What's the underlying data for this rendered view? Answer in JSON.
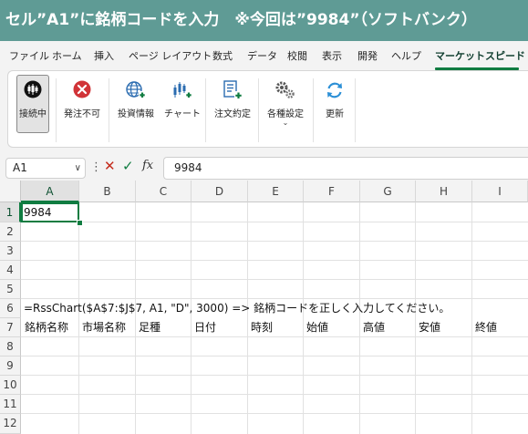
{
  "banner": {
    "title": "セル”A1”に銘柄コードを入力　※今回は”9984”（ソフトバンク）"
  },
  "menu": {
    "items": [
      "ファイル",
      "ホーム",
      "挿入",
      "ページ レイアウト",
      "数式",
      "データ",
      "校閲",
      "表示",
      "開発",
      "ヘルプ",
      "マーケットスピード II"
    ],
    "active": "マーケットスピード II"
  },
  "ribbon": {
    "buttons": [
      {
        "label": "接続中",
        "icon": "candlestick-connected-icon",
        "pressed": true
      },
      {
        "label": "発注不可",
        "icon": "error-x-icon"
      },
      {
        "label": "投資情報",
        "icon": "globe-plus-icon"
      },
      {
        "label": "チャート",
        "icon": "chart-plus-icon"
      },
      {
        "label": "注文約定",
        "icon": "document-plus-icon"
      },
      {
        "label": "各種設定",
        "icon": "gears-icon",
        "dropdown": true
      },
      {
        "label": "更新",
        "icon": "refresh-icon"
      }
    ],
    "colors": {
      "accent": "#107c41",
      "error": "#d13438",
      "info": "#2b6cb0",
      "banner": "#5f9b95"
    }
  },
  "formula_bar": {
    "name_box": "A1",
    "dots": "⋮",
    "cancel_glyph": "✕",
    "enter_glyph": "✓",
    "fx_label": "fx",
    "value": "9984"
  },
  "sheet": {
    "columns": [
      "A",
      "B",
      "C",
      "D",
      "E",
      "F",
      "G",
      "H",
      "I"
    ],
    "rows": [
      "1",
      "2",
      "3",
      "4",
      "5",
      "6",
      "7",
      "8",
      "9",
      "10",
      "11",
      "12"
    ],
    "selected_cell": "A1",
    "a1_value": "9984",
    "a6_text": "=RssChart($A$7:$J$7, A1, \"D\", 3000) => 銘柄コードを正しく入力してください。",
    "row7_headers": [
      "銘柄名称",
      "市場名称",
      "足種",
      "日付",
      "時刻",
      "始値",
      "高値",
      "安値",
      "終値"
    ]
  }
}
